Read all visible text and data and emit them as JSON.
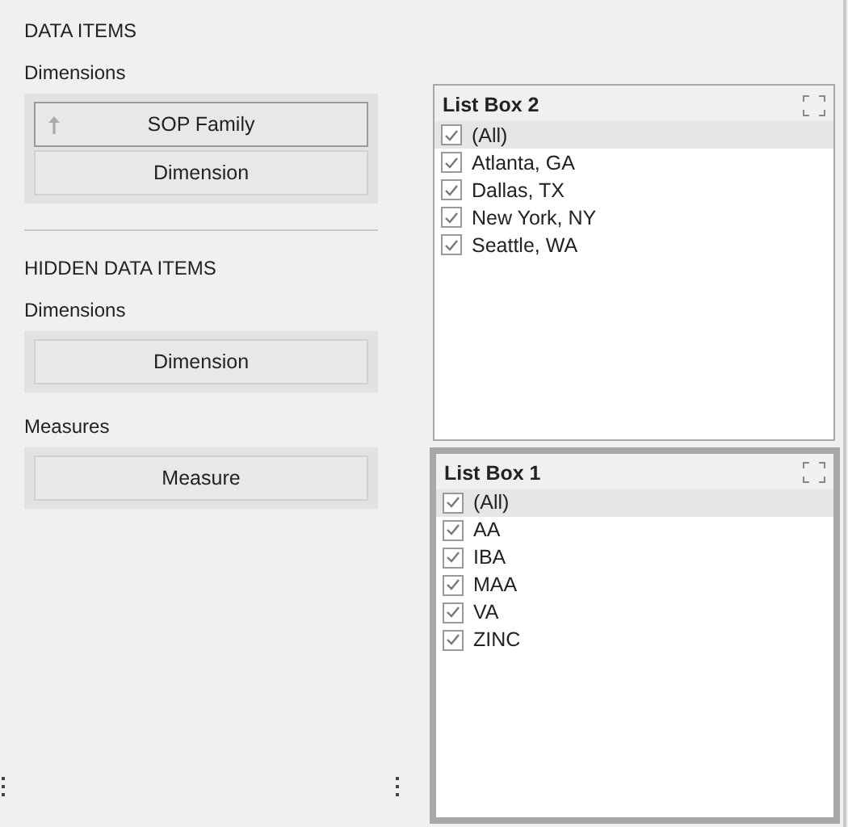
{
  "sections": [
    {
      "heading": "DATA ITEMS",
      "groups": [
        {
          "label": "Dimensions",
          "items": [
            {
              "label": "SOP Family",
              "kind": "sorted",
              "selected": true
            },
            {
              "label": "Dimension",
              "kind": "placeholder",
              "selected": false
            }
          ]
        }
      ]
    },
    {
      "heading": "HIDDEN DATA ITEMS",
      "groups": [
        {
          "label": "Dimensions",
          "items": [
            {
              "label": "Dimension",
              "kind": "placeholder",
              "selected": false
            }
          ]
        },
        {
          "label": "Measures",
          "items": [
            {
              "label": "Measure",
              "kind": "placeholder",
              "selected": false
            }
          ]
        }
      ]
    }
  ],
  "list_boxes": [
    {
      "title": "List Box 2",
      "selected": false,
      "items": [
        {
          "label": "(All)",
          "checked": true,
          "highlighted": true
        },
        {
          "label": "Atlanta, GA",
          "checked": true,
          "highlighted": false
        },
        {
          "label": "Dallas, TX",
          "checked": true,
          "highlighted": false
        },
        {
          "label": "New York, NY",
          "checked": true,
          "highlighted": false
        },
        {
          "label": "Seattle, WA",
          "checked": true,
          "highlighted": false
        }
      ]
    },
    {
      "title": "List Box 1",
      "selected": true,
      "items": [
        {
          "label": "(All)",
          "checked": true,
          "highlighted": true
        },
        {
          "label": "AA",
          "checked": true,
          "highlighted": false
        },
        {
          "label": "IBA",
          "checked": true,
          "highlighted": false
        },
        {
          "label": "MAA",
          "checked": true,
          "highlighted": false
        },
        {
          "label": "VA",
          "checked": true,
          "highlighted": false
        },
        {
          "label": "ZINC",
          "checked": true,
          "highlighted": false
        }
      ]
    }
  ]
}
